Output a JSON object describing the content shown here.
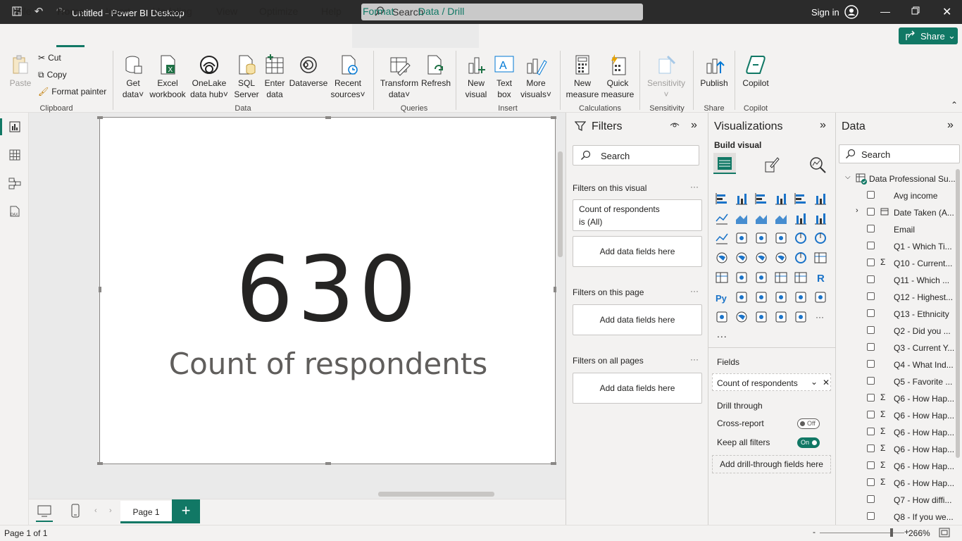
{
  "titlebar": {
    "doc_title": "Untitled - Power BI Desktop",
    "search_placeholder": "Search",
    "signin": "Sign in"
  },
  "menu": {
    "tabs": [
      "File",
      "Home",
      "Insert",
      "Modeling",
      "View",
      "Optimize",
      "Help",
      "Format",
      "Data / Drill"
    ],
    "active": "Home",
    "share": "Share"
  },
  "ribbon": {
    "clipboard": {
      "paste": "Paste",
      "cut": "Cut",
      "copy": "Copy",
      "format_painter": "Format painter",
      "group": "Clipboard"
    },
    "data": {
      "get_data": [
        "Get",
        "data"
      ],
      "excel": [
        "Excel",
        "workbook"
      ],
      "onelake": [
        "OneLake",
        "data hub"
      ],
      "sql": [
        "SQL",
        "Server"
      ],
      "enter": [
        "Enter",
        "data"
      ],
      "dataverse": "Dataverse",
      "recent": [
        "Recent",
        "sources"
      ],
      "group": "Data"
    },
    "queries": {
      "transform": [
        "Transform",
        "data"
      ],
      "refresh": "Refresh",
      "group": "Queries"
    },
    "insert": {
      "new_visual": [
        "New",
        "visual"
      ],
      "text_box": [
        "Text",
        "box"
      ],
      "more_visuals": [
        "More",
        "visuals"
      ],
      "group": "Insert"
    },
    "calculations": {
      "new_measure": [
        "New",
        "measure"
      ],
      "quick_measure": [
        "Quick",
        "measure"
      ],
      "group": "Calculations"
    },
    "sensitivity": {
      "label": "Sensitivity",
      "group": "Sensitivity"
    },
    "share": {
      "publish": "Publish",
      "group": "Share"
    },
    "copilot": {
      "label": "Copilot",
      "group": "Copilot"
    }
  },
  "canvas": {
    "card_value": "630",
    "card_label": "Count of respondents"
  },
  "pages": {
    "current": "Page 1"
  },
  "status": {
    "page_info": "Page 1 of 1",
    "zoom": "266%",
    "zoom_level": 0.85
  },
  "filters": {
    "title": "Filters",
    "search": "Search",
    "on_visual": "Filters on this visual",
    "visual_filter": [
      "Count of respondents",
      "is (All)"
    ],
    "add_fields": "Add data fields here",
    "on_page": "Filters on this page",
    "on_all": "Filters on all pages"
  },
  "visualizations": {
    "title": "Visualizations",
    "build": "Build visual",
    "fields_label": "Fields",
    "field_value": "Count of respondents",
    "drill_through": "Drill through",
    "cross_report": "Cross-report",
    "cross_report_state": "Off",
    "keep_filters": "Keep all filters",
    "keep_filters_state": "On",
    "add_drill": "Add drill-through fields here",
    "more": "..."
  },
  "data_pane": {
    "title": "Data",
    "search": "Search",
    "table": "Data Professional Su...",
    "fields": [
      {
        "name": "Avg income",
        "sigma": false,
        "date": false
      },
      {
        "name": "Date Taken (A...",
        "sigma": false,
        "date": true
      },
      {
        "name": "Email",
        "sigma": false,
        "date": false
      },
      {
        "name": "Q1 - Which Ti...",
        "sigma": false,
        "date": false
      },
      {
        "name": "Q10 - Current...",
        "sigma": true,
        "date": false
      },
      {
        "name": "Q11 - Which ...",
        "sigma": false,
        "date": false
      },
      {
        "name": "Q12 - Highest...",
        "sigma": false,
        "date": false
      },
      {
        "name": "Q13 - Ethnicity",
        "sigma": false,
        "date": false
      },
      {
        "name": "Q2 - Did you ...",
        "sigma": false,
        "date": false
      },
      {
        "name": "Q3 - Current Y...",
        "sigma": false,
        "date": false
      },
      {
        "name": "Q4 - What Ind...",
        "sigma": false,
        "date": false
      },
      {
        "name": "Q5 - Favorite ...",
        "sigma": false,
        "date": false
      },
      {
        "name": "Q6 - How Hap...",
        "sigma": true,
        "date": false
      },
      {
        "name": "Q6 - How Hap...",
        "sigma": true,
        "date": false
      },
      {
        "name": "Q6 - How Hap...",
        "sigma": true,
        "date": false
      },
      {
        "name": "Q6 - How Hap...",
        "sigma": true,
        "date": false
      },
      {
        "name": "Q6 - How Hap...",
        "sigma": true,
        "date": false
      },
      {
        "name": "Q6 - How Hap...",
        "sigma": true,
        "date": false
      },
      {
        "name": "Q7 - How diffi...",
        "sigma": false,
        "date": false
      },
      {
        "name": "Q8 - If you we...",
        "sigma": false,
        "date": false
      }
    ]
  },
  "colors": {
    "accent": "#117865",
    "chrome": "#2b2b2b"
  }
}
